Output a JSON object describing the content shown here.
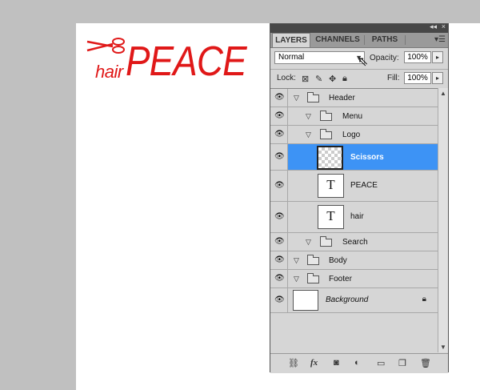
{
  "document": {
    "logo_small": "hair",
    "logo_large": "PEACE"
  },
  "panel": {
    "tabs": [
      "LAYERS",
      "CHANNELS",
      "PATHS"
    ],
    "collapse_icon": "double-arrow-icon",
    "close_icon": "close-icon",
    "menu_icon": "panel-menu-icon",
    "blend_mode": "Normal",
    "opacity_label": "Opacity:",
    "opacity_value": "100%",
    "lock_label": "Lock:",
    "fill_label": "Fill:",
    "fill_value": "100%",
    "layers": [
      {
        "name": "Header",
        "type": "group",
        "level": 0
      },
      {
        "name": "Menu",
        "type": "group",
        "level": 1
      },
      {
        "name": "Logo",
        "type": "group",
        "level": 1
      },
      {
        "name": "Scissors",
        "type": "image",
        "level": 2,
        "selected": true
      },
      {
        "name": "PEACE",
        "type": "text",
        "level": 2
      },
      {
        "name": "hair",
        "type": "text",
        "level": 2
      },
      {
        "name": "Search",
        "type": "group",
        "level": 1
      },
      {
        "name": "Body",
        "type": "group",
        "level": 0
      },
      {
        "name": "Footer",
        "type": "group",
        "level": 0
      },
      {
        "name": "Background",
        "type": "background",
        "level": 0
      }
    ],
    "text_thumb_glyph": "T",
    "footer_icons": [
      "link-icon",
      "fx-icon",
      "mask-icon",
      "adjustment-icon",
      "new-group-icon",
      "new-layer-icon",
      "trash-icon"
    ],
    "fx_label": "fx"
  },
  "colors": {
    "logo_red": "#e01818",
    "selection_blue": "#3d93f5"
  }
}
